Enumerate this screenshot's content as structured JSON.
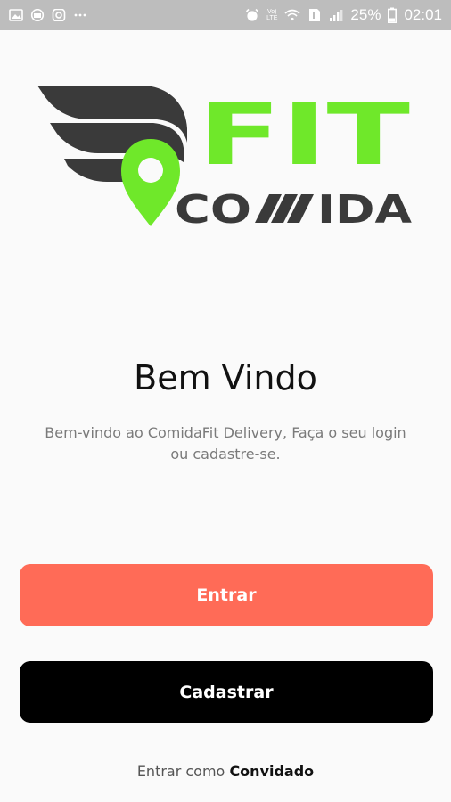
{
  "status_bar": {
    "battery_percent": "25%",
    "time": "02:01",
    "network_label_top": "Vo)",
    "network_label_bottom": "LTE",
    "left_icons": [
      "image-icon",
      "mail-icon",
      "instagram-icon",
      "more-icon"
    ],
    "right_icons": [
      "alarm-icon",
      "volte-icon",
      "wifi-icon",
      "sim-icon",
      "signal-icon",
      "battery-icon"
    ]
  },
  "logo": {
    "text_top": "FIT",
    "text_bottom_left": "CO",
    "text_bottom_right": "IDA",
    "colors": {
      "green": "#6fe82a",
      "dark": "#3a3a3a"
    }
  },
  "welcome": {
    "title": "Bem Vindo",
    "subtitle": "Bem-vindo ao  ComidaFit Delivery, Faça o seu login ou cadastre-se."
  },
  "buttons": {
    "login_label": "Entrar",
    "register_label": "Cadastrar"
  },
  "guest": {
    "prefix": "Entrar como ",
    "link_label": "Convidado"
  },
  "colors": {
    "login_button": "#ff6b57",
    "register_button": "#000000",
    "background": "#fafafa"
  }
}
